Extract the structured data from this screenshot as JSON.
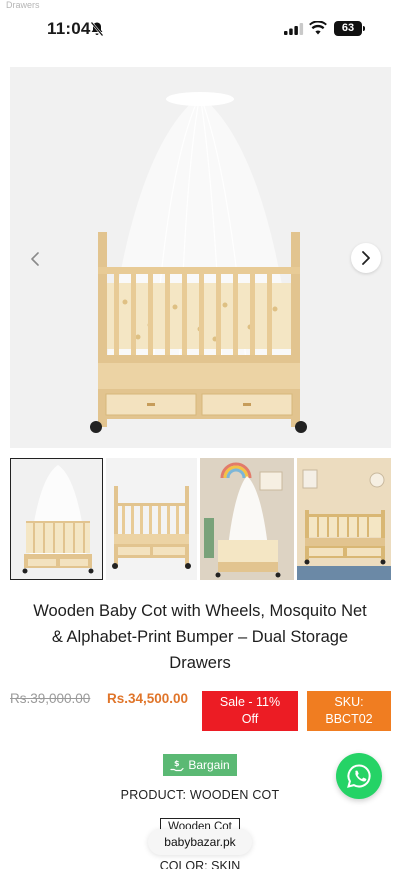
{
  "breadcrumb": {
    "text": "Drawers"
  },
  "status_bar": {
    "time": "11:04",
    "battery": "63"
  },
  "carousel": {
    "prev_icon": "chevron-left-icon",
    "next_icon": "chevron-right-icon"
  },
  "product": {
    "title_line1": "Wooden Baby Cot with Wheels, Mosquito Net",
    "title_line2": "& Alphabet-Print Bumper – Dual Storage",
    "title_line3": "Drawers",
    "old_price": "Rs.39,000.00",
    "new_price": "Rs.34,500.00",
    "sale_line1": "Sale - 11%",
    "sale_line2": "Off",
    "sku_line1": "SKU:",
    "sku_line2": "BBCT02",
    "bargain_label": "Bargain",
    "product_line": "PRODUCT: WOODEN COT",
    "type_box": "Wooden Cot",
    "color_line": "COLOR: SKIN"
  },
  "browser": {
    "url": "babybazar.pk"
  },
  "colors": {
    "sale": "#ec1c24",
    "sku": "#f07d21",
    "price": "#e0752a",
    "bargain": "#5bb974",
    "whatsapp": "#25d366"
  }
}
